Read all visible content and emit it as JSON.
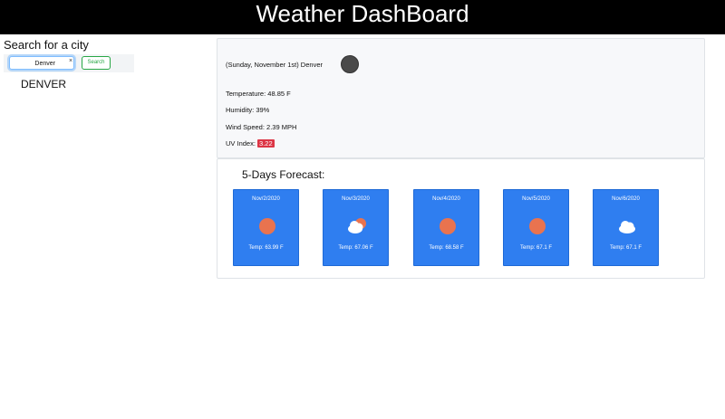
{
  "header": {
    "title": "Weather DashBoard"
  },
  "search": {
    "title": "Search for a city",
    "value": "Denver",
    "button_label": "Search",
    "clear_icon": "×"
  },
  "history": [
    "DENVER"
  ],
  "current": {
    "title": "(Sunday, November 1st) Denver",
    "icon": "dark-circle-icon",
    "temperature_label": "Temperature: 48.85 F",
    "humidity_label": "Humidity: 39%",
    "wind_label": "Wind Speed: 2.39 MPH",
    "uv_label": "UV Index:",
    "uv_value": "3.22",
    "uv_color": "#dc3545"
  },
  "forecast": {
    "title": "5-Days Forecast:",
    "days": [
      {
        "date": "Nov/2/2020",
        "temp": "Temp: 63.99 F",
        "icon": "sun-icon"
      },
      {
        "date": "Nov/3/2020",
        "temp": "Temp: 67.06 F",
        "icon": "partly-cloudy-icon"
      },
      {
        "date": "Nov/4/2020",
        "temp": "Temp: 68.58 F",
        "icon": "sun-icon"
      },
      {
        "date": "Nov/5/2020",
        "temp": "Temp: 67.1 F",
        "icon": "sun-icon"
      },
      {
        "date": "Nov/6/2020",
        "temp": "Temp: 67.1 F",
        "icon": "cloud-icon"
      }
    ]
  },
  "colors": {
    "header_bg": "#000000",
    "card_bg": "#2f7ef0",
    "search_button": "#28a745"
  }
}
